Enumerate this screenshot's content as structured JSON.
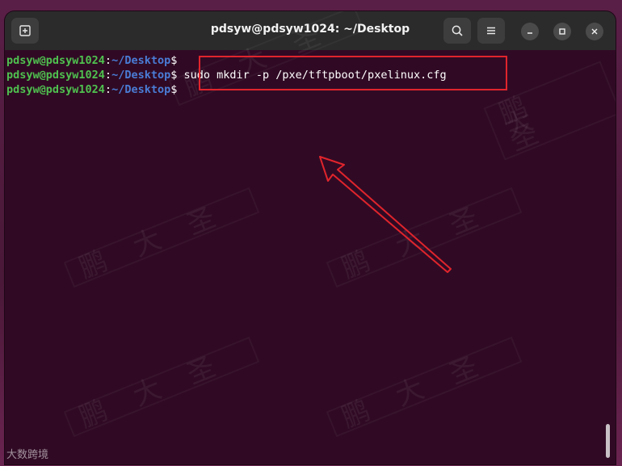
{
  "window": {
    "title": "pdsyw@pdsyw1024: ~/Desktop"
  },
  "terminal": {
    "lines": [
      {
        "user": "pdsyw@pdsyw1024",
        "sep": ":",
        "path": "~/Desktop",
        "prompt": "$",
        "command": ""
      },
      {
        "user": "pdsyw@pdsyw1024",
        "sep": ":",
        "path": "~/Desktop",
        "prompt": "$",
        "command": " sudo mkdir -p /pxe/tftpboot/pxelinux.cfg"
      },
      {
        "user": "pdsyw@pdsyw1024",
        "sep": ":",
        "path": "~/Desktop",
        "prompt": "$",
        "command": ""
      }
    ]
  },
  "annotation": {
    "color": "#e0242c"
  },
  "watermark": {
    "text": "鹏大圣"
  },
  "corner_logo": {
    "text": "大数跨境"
  },
  "colors": {
    "terminal_bg": "#300a24",
    "titlebar_bg": "#2b2b2b",
    "user_green": "#4fc14f",
    "path_blue": "#4a7cd6"
  },
  "icons": {
    "new_tab": "new-tab-icon",
    "search": "search-icon",
    "menu": "hamburger-menu-icon",
    "minimize": "minimize-icon",
    "maximize": "maximize-icon",
    "close": "close-icon"
  }
}
